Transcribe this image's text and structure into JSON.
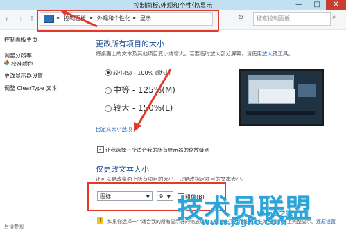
{
  "window": {
    "title": "控制面板\\外观和个性化\\显示",
    "minimize": "—",
    "maximize": "□",
    "close": "✕"
  },
  "nav": {
    "back": "←",
    "forward": "→",
    "up": "↑",
    "crumbs": [
      "控制面板",
      "外观和个性化",
      "显示"
    ],
    "separators": [
      "▸",
      "▸",
      "▸"
    ],
    "refresh": "↻",
    "search_placeholder": "搜索控制面板",
    "search_icon": "⌕"
  },
  "sidebar": {
    "items": [
      {
        "label": "控制面板主页"
      },
      {
        "label": "调整分辨率"
      },
      {
        "label": "校准颜色"
      },
      {
        "label": "更改显示器设置"
      },
      {
        "label": "调整 ClearType 文本"
      }
    ],
    "see_also": "另请参阅"
  },
  "main": {
    "heading1": "更改所有项目的大小",
    "desc1": "将桌面上的文本及其他项目变小或增大。若要临时放大部分屏幕，请使用",
    "desc1_link": "放大镜",
    "desc1_tail": "工具。",
    "options": [
      {
        "label": "较小(S) - 100% (默认)",
        "selected": true
      },
      {
        "label": "中等 - 125%(M)",
        "selected": false
      },
      {
        "label": "较大 - 150%(L)",
        "selected": false
      }
    ],
    "custom_link": "自定义大小选项",
    "checkbox_label": "让我选择一个适合我的所有显示器的缩放级别",
    "checkbox_checked": "✓",
    "heading2": "仅更改文本大小",
    "desc2": "还可以更改桌面上所有项目的大小，只更改指定项目的文本大小。",
    "item_select": "图标",
    "size_select": "9",
    "bold_label": "粗体(B)",
    "footer_text": "如果你选择一个适合我的所有显示器的缩放级别，则某些项目可能无法在某些显示器上完整显示。",
    "footer_link": "还原设置"
  },
  "watermark": {
    "text": "技术员联盟",
    "sub": "www.jsgho.com",
    "tag": "Win8之家"
  },
  "colors": {
    "accent": "#1f4e96",
    "highlight": "#e23a2a",
    "watermark": "#2da4d8"
  }
}
